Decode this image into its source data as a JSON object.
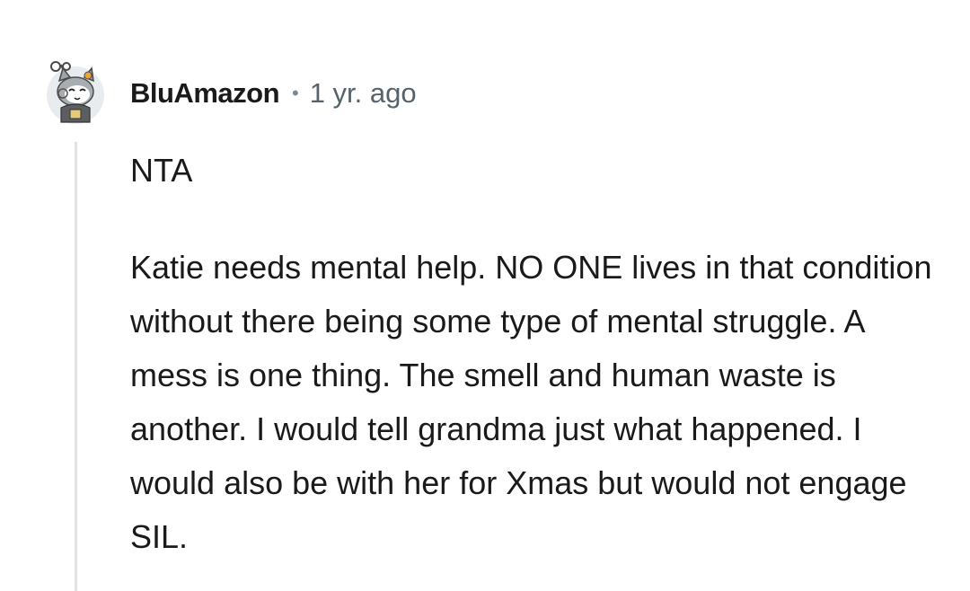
{
  "comment": {
    "username": "BluAmazon",
    "separator": "•",
    "timestamp": "1 yr. ago",
    "avatar_icon": "snoo-avatar-icon",
    "paragraphs": [
      "NTA",
      "Katie needs mental help. NO ONE lives in that condition without there being some type of mental struggle. A mess is one thing. The smell and human waste is another. I would tell grandma just what happened. I would also be with her for Xmas but would not engage SIL."
    ]
  }
}
